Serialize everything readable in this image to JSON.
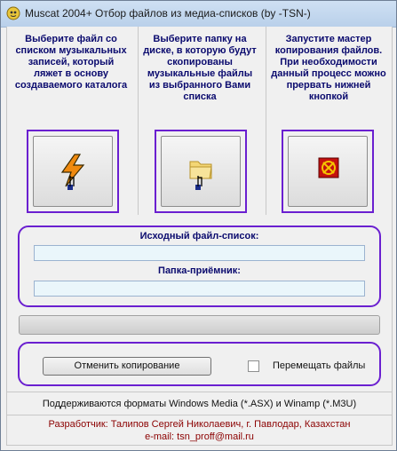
{
  "window": {
    "title": "Muscat 2004+   Отбор файлов из медиа-списков (by -TSN-)"
  },
  "columns": [
    {
      "text": "Выберите файл со списком музыкальных записей, который ляжет в основу создаваемого каталога",
      "icon": "winamp-lightning-icon"
    },
    {
      "text": "Выберите папку на диске, в которую будут скопированы музыкальные файлы из выбранного Вами списка",
      "icon": "folder-icon"
    },
    {
      "text": "Запустите мастер копирования файлов. При необходимости данный процесс можно прервать нижней кнопкой",
      "icon": "copy-wizard-icon"
    }
  ],
  "paths": {
    "source_label": "Исходный файл-список:",
    "source_value": "",
    "target_label": "Папка-приёмник:",
    "target_value": ""
  },
  "progress": {
    "value": 0
  },
  "controls": {
    "cancel_label": "Отменить копирование",
    "move_files_label": "Перемещать файлы",
    "move_files_checked": false
  },
  "footer": {
    "formats": "Поддерживаются форматы Windows Media (*.ASX) и Winamp (*.M3U)",
    "developer": "Разработчик: Талипов Сергей Николаевич, г. Павлодар, Казахстан",
    "email": "e-mail: tsn_proff@mail.ru"
  },
  "colors": {
    "accent_border": "#6a1fd0",
    "label_text": "#0a0a6e",
    "developer_text": "#8b0000",
    "field_bg": "#eaf6fb"
  }
}
